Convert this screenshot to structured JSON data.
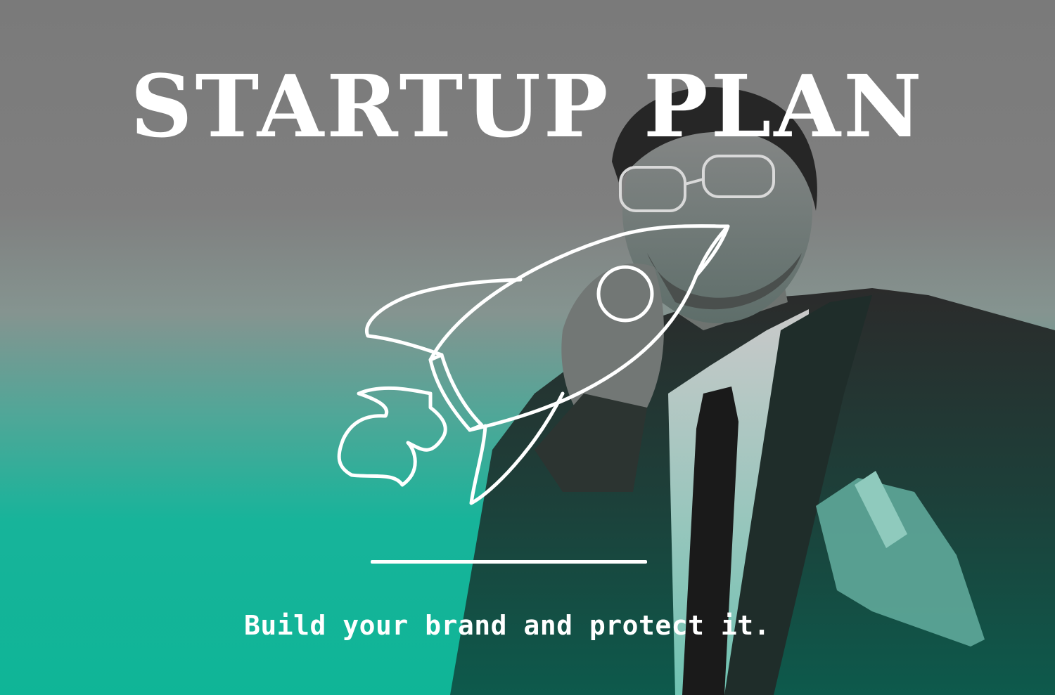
{
  "poster": {
    "title": "STARTUP PLAN",
    "tagline": "Build your brand and protect it.",
    "icon": "rocket-icon",
    "colors": {
      "top": "#7d7d7d",
      "bottom": "#0fb597",
      "text": "#ffffff"
    }
  }
}
